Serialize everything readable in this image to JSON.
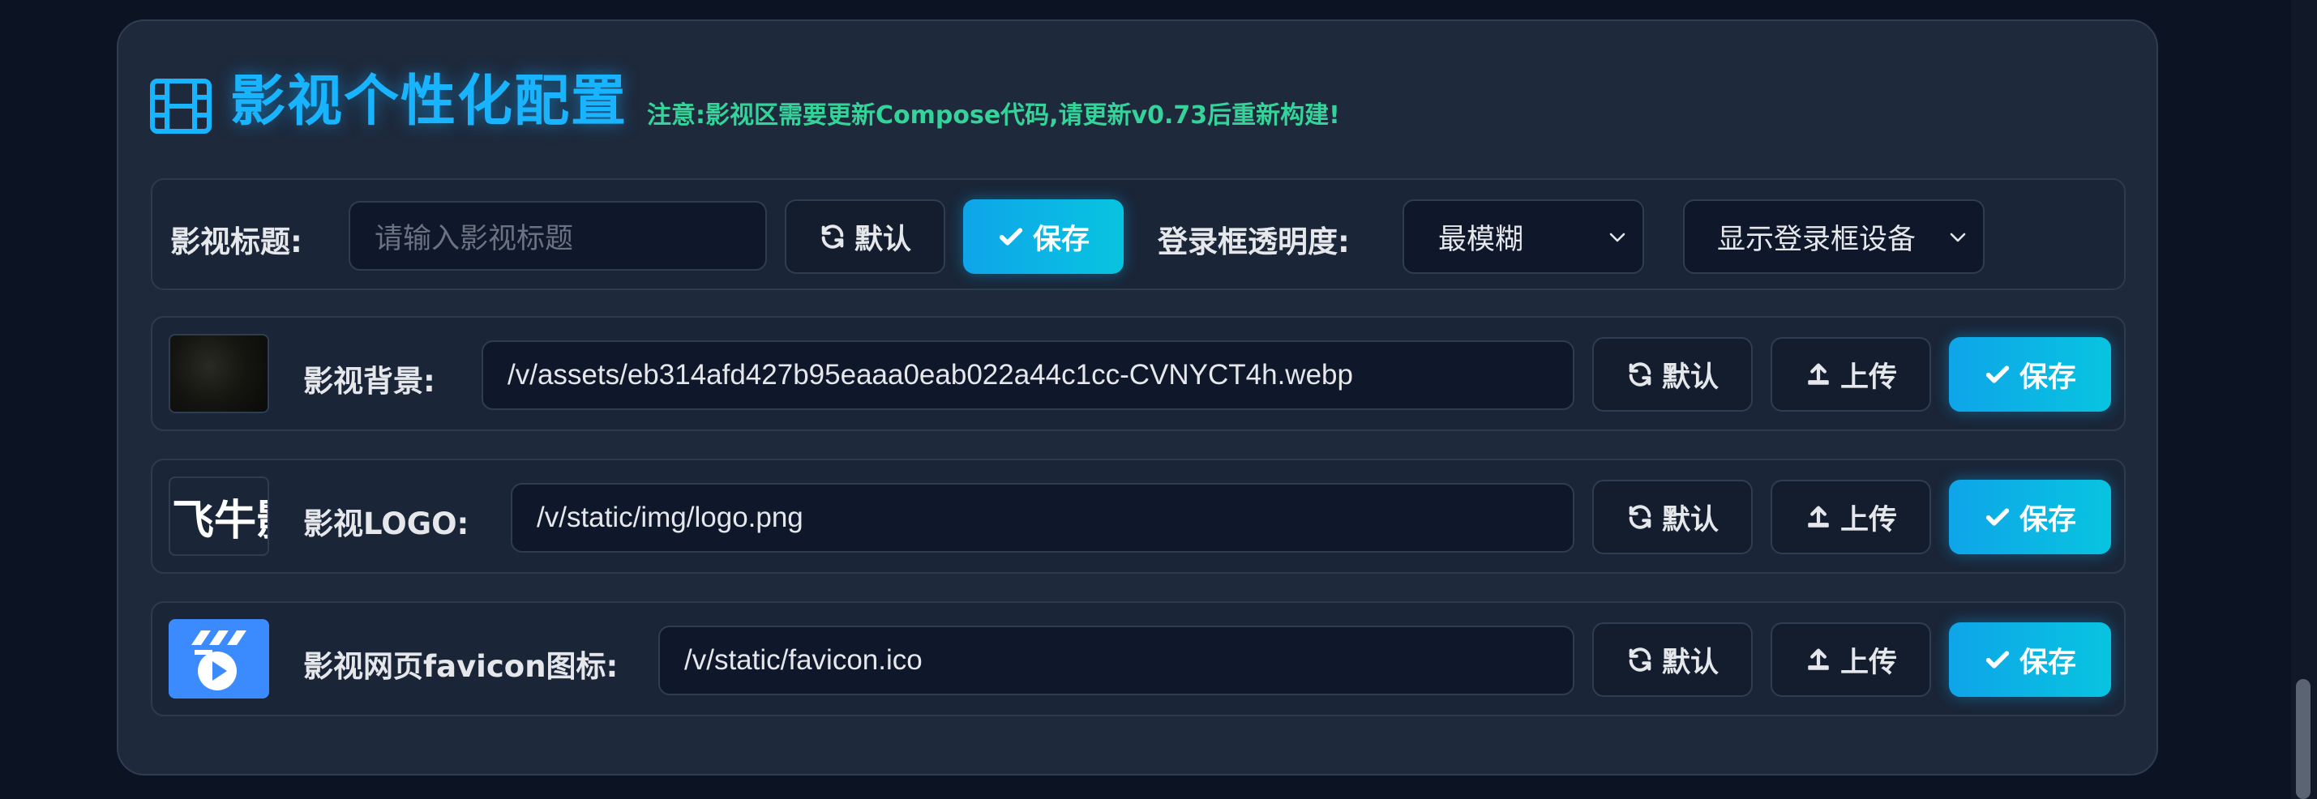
{
  "header": {
    "title": "影视个性化配置",
    "notice": "注意:影视区需要更新Compose代码,请更新v0.73后重新构建!",
    "icon": "film-icon"
  },
  "row_title": {
    "label": "影视标题:",
    "input_placeholder": "请输入影视标题",
    "input_value": "",
    "default_label": "默认",
    "save_label": "保存",
    "opacity_label": "登录框透明度:",
    "opacity_selected": "最模糊",
    "device_selected": "显示登录框设备"
  },
  "row_background": {
    "label": "影视背景:",
    "value": "/v/assets/eb314afd427b95eaaa0eab022a44c1cc-CVNYCT4h.webp",
    "default_label": "默认",
    "upload_label": "上传",
    "save_label": "保存"
  },
  "row_logo": {
    "label": "影视LOGO:",
    "value": "/v/static/img/logo.png",
    "thumb_text": "飞牛影",
    "default_label": "默认",
    "upload_label": "上传",
    "save_label": "保存"
  },
  "row_favicon": {
    "label": "影视网页favicon图标:",
    "value": "/v/static/favicon.ico",
    "default_label": "默认",
    "upload_label": "上传",
    "save_label": "保存"
  },
  "colors": {
    "accent": "#19b4ff",
    "notice": "#34d399",
    "primary_button": "#0ea5e9",
    "panel": "#1e293b",
    "background": "#0c1323"
  }
}
